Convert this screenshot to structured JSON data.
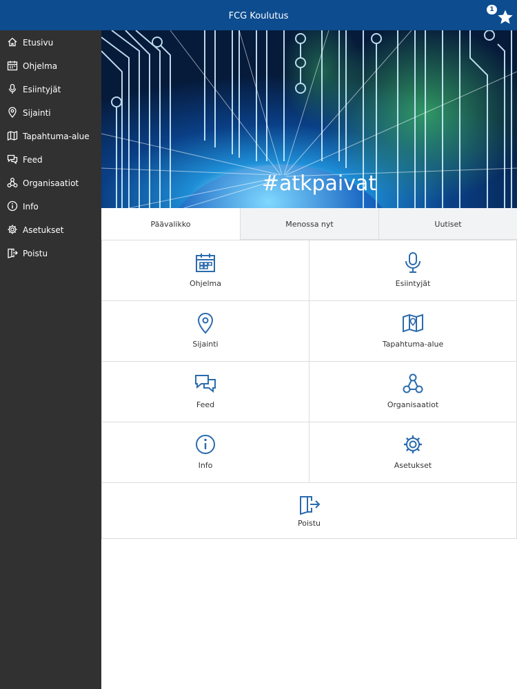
{
  "app": {
    "title": "FCG Koulutus",
    "favorites_count": "1"
  },
  "sidebar": {
    "items": [
      {
        "label": "Etusivu",
        "icon": "home-icon"
      },
      {
        "label": "Ohjelma",
        "icon": "calendar-icon"
      },
      {
        "label": "Esiintyjät",
        "icon": "microphone-icon"
      },
      {
        "label": "Sijainti",
        "icon": "location-pin-icon"
      },
      {
        "label": "Tapahtuma-alue",
        "icon": "map-icon"
      },
      {
        "label": "Feed",
        "icon": "chat-icon"
      },
      {
        "label": "Organisaatiot",
        "icon": "network-icon"
      },
      {
        "label": "Info",
        "icon": "info-icon"
      },
      {
        "label": "Asetukset",
        "icon": "gear-icon"
      },
      {
        "label": "Poistu",
        "icon": "exit-icon"
      }
    ]
  },
  "hero": {
    "hashtag": "#atkpaivat"
  },
  "tabs": [
    {
      "label": "Päävalikko",
      "active": true
    },
    {
      "label": "Menossa nyt",
      "active": false
    },
    {
      "label": "Uutiset",
      "active": false
    }
  ],
  "tiles": [
    {
      "label": "Ohjelma",
      "icon": "calendar-icon"
    },
    {
      "label": "Esiintyjät",
      "icon": "microphone-icon"
    },
    {
      "label": "Sijainti",
      "icon": "location-pin-icon"
    },
    {
      "label": "Tapahtuma-alue",
      "icon": "map-icon"
    },
    {
      "label": "Feed",
      "icon": "chat-icon"
    },
    {
      "label": "Organisaatiot",
      "icon": "network-icon"
    },
    {
      "label": "Info",
      "icon": "info-icon"
    },
    {
      "label": "Asetukset",
      "icon": "gear-icon"
    },
    {
      "label": "Poistu",
      "icon": "exit-icon"
    }
  ],
  "colors": {
    "accent": "#0d4c8f",
    "sidebar": "#313131",
    "icon": "#2a6aad"
  }
}
